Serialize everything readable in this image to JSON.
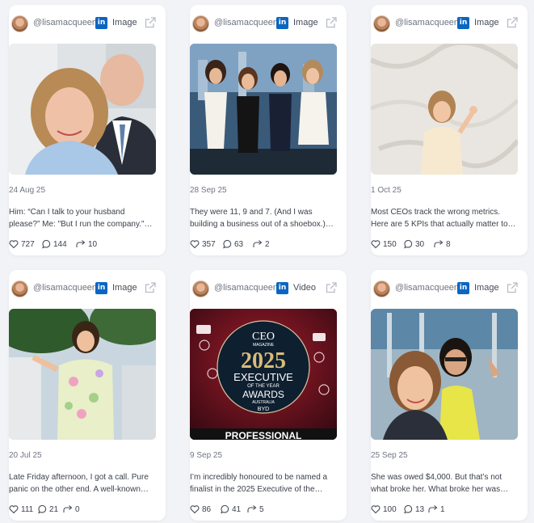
{
  "cards": [
    {
      "handle": "@lisamacqueen",
      "network": "in",
      "type": "Image",
      "date": "24 Aug 25",
      "caption": [
        "Him: “Can I talk to your husband",
        "please?” Me: \"But I run the company.\"…"
      ],
      "likes": "727",
      "comments": "144",
      "shares": "10"
    },
    {
      "handle": "@lisamacqueen",
      "network": "in",
      "type": "Image",
      "date": "28 Sep 25",
      "caption": [
        "They were 11, 9 and 7. (And I was",
        "building a business out of a shoebox.)…"
      ],
      "likes": "357",
      "comments": "63",
      "shares": "2"
    },
    {
      "handle": "@lisamacqueen",
      "network": "in",
      "type": "Image",
      "date": "1 Oct 25",
      "caption": [
        "Most CEOs track the wrong metrics.",
        "Here are 5 KPIs that actually matter to…"
      ],
      "likes": "150",
      "comments": "30",
      "shares": "8"
    },
    {
      "handle": "@lisamacqueen",
      "network": "in",
      "type": "Image",
      "date": "20 Jul 25",
      "caption": [
        "Late Friday afternoon, I got a call. Pure",
        "panic on the other end. A well-known…"
      ],
      "likes": "111",
      "comments": "21",
      "shares": "0"
    },
    {
      "handle": "@lisamacqueen",
      "network": "in",
      "type": "Video",
      "date": "9 Sep 25",
      "caption": [
        "I’m incredibly honoured to be named a",
        "finalist in the 2025 Executive of the…"
      ],
      "likes": "86",
      "comments": "41",
      "shares": "5",
      "media_text": {
        "mag": "CEO",
        "mag2": "MAGAZINE",
        "year": "2025",
        "line1": "EXECUTIVE",
        "line2": "OF THE YEAR",
        "line3": "AWARDS",
        "line4": "AUSTRALIA",
        "sponsor": "BYD",
        "banner": "PROFESSIONAL"
      }
    },
    {
      "handle": "@lisamacqueen",
      "network": "in",
      "type": "Image",
      "date": "25 Sep 25",
      "caption": [
        "She was owed $4,000. But that’s not",
        "what broke her. What broke her was…"
      ],
      "likes": "100",
      "comments": "13",
      "shares": "1"
    }
  ],
  "colors": {
    "linkedin": "#0a66c2",
    "background": "#f2f3f7",
    "card": "#ffffff"
  },
  "icons": {
    "like": "heart-icon",
    "comment": "comment-icon",
    "share": "share-icon",
    "open": "external-link-icon"
  }
}
